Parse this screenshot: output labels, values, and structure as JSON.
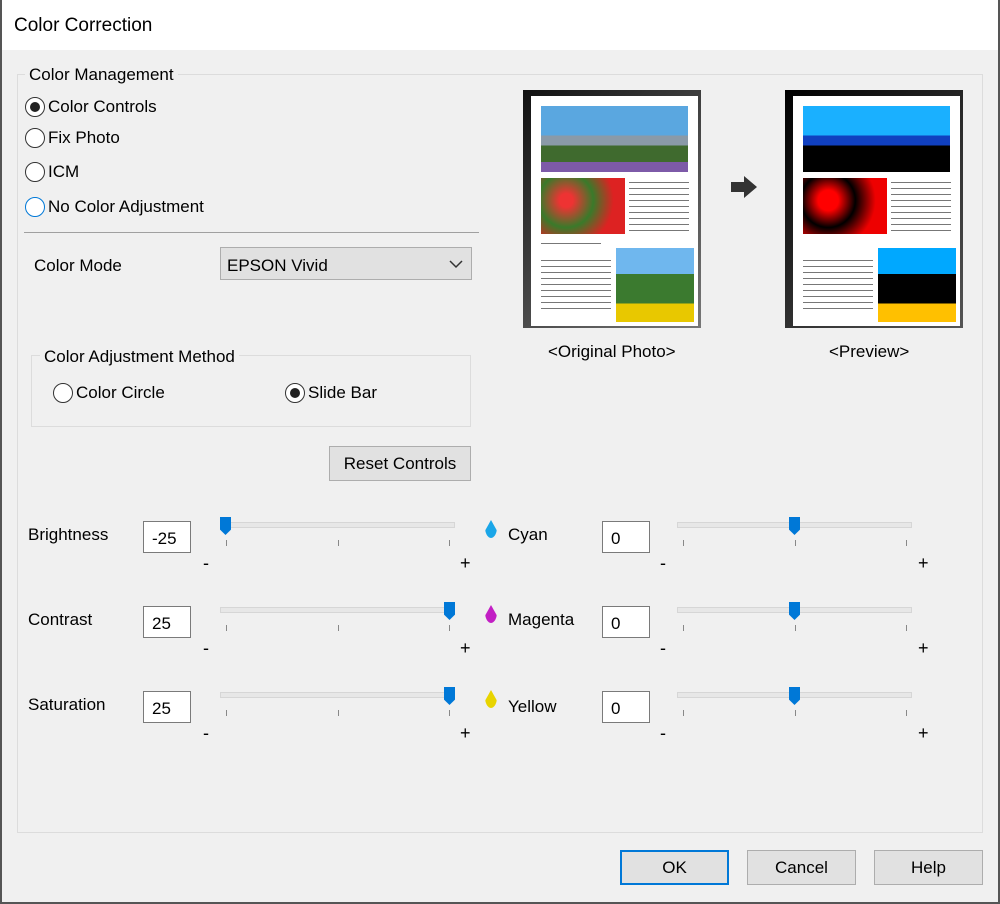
{
  "window": {
    "title": "Color Correction"
  },
  "color_management": {
    "label": "Color Management",
    "options": [
      {
        "label": "Color Controls",
        "selected": true
      },
      {
        "label": "Fix Photo",
        "selected": false
      },
      {
        "label": "ICM",
        "selected": false
      },
      {
        "label": "No Color Adjustment",
        "selected": false,
        "focused": true
      }
    ]
  },
  "color_mode": {
    "label": "Color Mode",
    "value": "EPSON Vivid",
    "icon": "chevron-down-icon"
  },
  "adjustment_method": {
    "label": "Color Adjustment Method",
    "options": [
      {
        "label": "Color Circle",
        "selected": false
      },
      {
        "label": "Slide Bar",
        "selected": true
      }
    ]
  },
  "reset_label": "Reset Controls",
  "preview": {
    "original_label": "<Original Photo>",
    "preview_label": "<Preview>",
    "arrow_icon": "arrow-right-icon"
  },
  "sliders_left": [
    {
      "label": "Brightness",
      "value": "-25",
      "fraction": 0.0
    },
    {
      "label": "Contrast",
      "value": "25",
      "fraction": 1.0
    },
    {
      "label": "Saturation",
      "value": "25",
      "fraction": 1.0
    }
  ],
  "sliders_right": [
    {
      "label": "Cyan",
      "value": "0",
      "fraction": 0.5,
      "color": "#1aa6e8",
      "icon": "cyan-drop-icon"
    },
    {
      "label": "Magenta",
      "value": "0",
      "fraction": 0.5,
      "color": "#c21fc4",
      "icon": "magenta-drop-icon"
    },
    {
      "label": "Yellow",
      "value": "0",
      "fraction": 0.5,
      "color": "#e8d400",
      "icon": "yellow-drop-icon"
    }
  ],
  "minus": "-",
  "plus": "+",
  "buttons": {
    "ok": "OK",
    "cancel": "Cancel",
    "help": "Help"
  },
  "colors": {
    "accent": "#0078d7"
  }
}
